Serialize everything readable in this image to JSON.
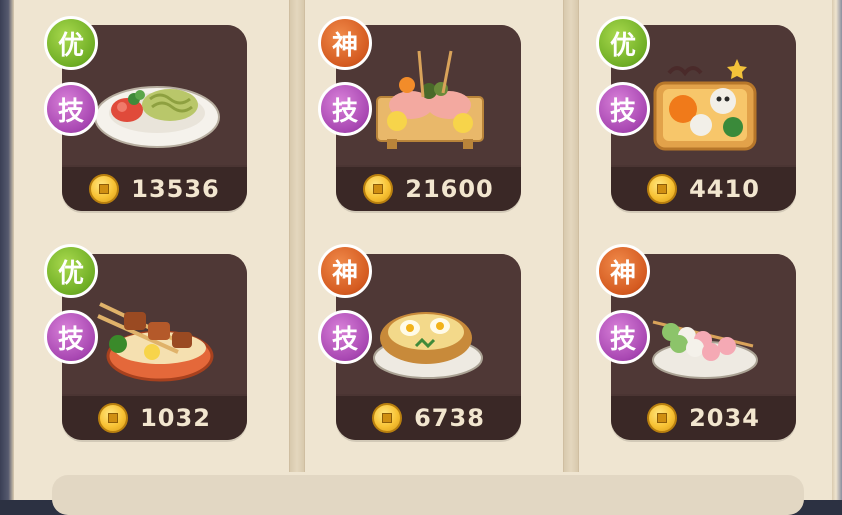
{
  "colors": {
    "card_bg": "#4b3533",
    "price_bar": "#3a2826",
    "board": "#efe5d1",
    "badge_good": "#6fae25",
    "badge_god": "#d45a20",
    "badge_skill": "#a847b2",
    "coin": "#f8c234"
  },
  "dishes": [
    {
      "quality_badge": "优",
      "skill_badge": "技",
      "price": "13536",
      "icon": "pasta-plate-icon"
    },
    {
      "quality_badge": "神",
      "skill_badge": "技",
      "price": "21600",
      "icon": "sashimi-board-icon"
    },
    {
      "quality_badge": "优",
      "skill_badge": "技",
      "price": "4410",
      "icon": "halloween-bento-icon"
    },
    {
      "quality_badge": "优",
      "skill_badge": "技",
      "price": "1032",
      "icon": "skewer-bowl-icon"
    },
    {
      "quality_badge": "神",
      "skill_badge": "技",
      "price": "6738",
      "icon": "baked-potato-icon"
    },
    {
      "quality_badge": "神",
      "skill_badge": "技",
      "price": "2034",
      "icon": "dango-plate-icon"
    }
  ]
}
